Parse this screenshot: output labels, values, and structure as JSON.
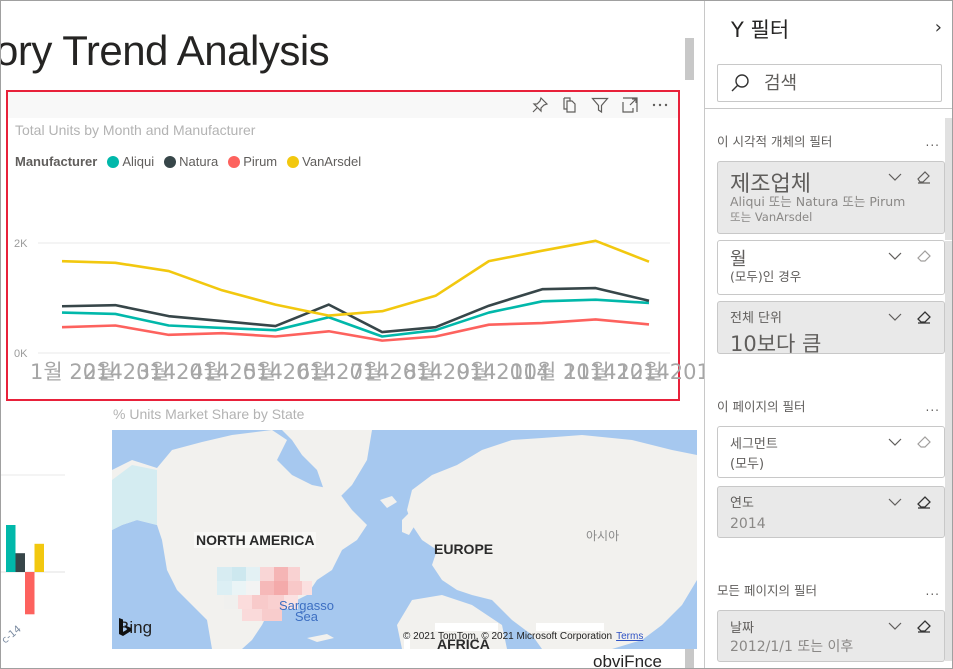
{
  "canvas": {
    "page_title": "ory Trend Analysis",
    "cut_text": "obviFnce"
  },
  "line_visual": {
    "header_icons": [
      "pin-icon",
      "copy-icon",
      "filter-icon",
      "focus-mode-icon",
      "more-options-icon"
    ],
    "more_label": "⋯"
  },
  "map_visual": {
    "title": "% Units Market Share by State",
    "labels": {
      "north_america": "NORTH AMERICA",
      "europe": "EUROPE",
      "asia": "아시아",
      "sea_line1": "Sargasso",
      "sea_line2": "Sea",
      "africa": "AFRICA"
    },
    "bing": "Bing",
    "copyright": "© 2021 TomTom, © 2021 Microsoft Corporation",
    "terms": "Terms"
  },
  "bar_fragment": {
    "axis_label": "c-14",
    "colors": [
      "#01B8AA",
      "#374649",
      "#FD625E",
      "#F2C80F"
    ],
    "values": [
      1.0,
      0.4,
      -0.9,
      0.6
    ]
  },
  "chart_data": {
    "type": "line",
    "title": "Total Units by Month and Manufacturer",
    "legend_title": "Manufacturer",
    "legend_position": "top-left",
    "xlabel": "",
    "ylabel": "",
    "x": [
      "1월 2014",
      "2월 2014",
      "3월 2014",
      "4월 2014",
      "5월 2014",
      "6월 2014",
      "7월 2014",
      "8월 2014",
      "9월 2014",
      "10월 2014",
      "11월 2014",
      "12월 2014"
    ],
    "x_tick_overlap_text": [
      "1월",
      "24월",
      "34월",
      "44월",
      "54월",
      "64월",
      "74월",
      "84월",
      "94월",
      "10월",
      "11월",
      "12월",
      "14일"
    ],
    "yticks": [
      "0K",
      "2K"
    ],
    "ylim": [
      0,
      2000
    ],
    "grid": true,
    "series": [
      {
        "name": "Aliqui",
        "color": "#01B8AA",
        "values": [
          735,
          710,
          500,
          455,
          415,
          650,
          300,
          415,
          735,
          940,
          970,
          910
        ]
      },
      {
        "name": "Natura",
        "color": "#374649",
        "values": [
          850,
          870,
          670,
          580,
          490,
          880,
          380,
          470,
          860,
          1160,
          1180,
          950
        ]
      },
      {
        "name": "Pirum",
        "color": "#FD625E",
        "values": [
          470,
          500,
          330,
          360,
          300,
          395,
          225,
          300,
          515,
          545,
          610,
          520
        ]
      },
      {
        "name": "VanArsdel",
        "color": "#F2C80F",
        "values": [
          1670,
          1640,
          1490,
          1140,
          880,
          680,
          760,
          1040,
          1670,
          1860,
          2040,
          1660
        ]
      }
    ]
  },
  "filter_pane": {
    "title": "Y 필터",
    "collapse": "›",
    "search_placeholder": "검색",
    "sections": {
      "visual": {
        "title": "이 시각적 개체의 필터",
        "more": "...",
        "cards": [
          {
            "name": "제조업체",
            "value": "Aliqui 또는 Natura 또는 Pirum 또는 VanArsdel",
            "value_line1": "Aliqui 또는 Natura 또는 Pirum",
            "value_line2": "또는 VanArsdel",
            "active": true
          },
          {
            "name": "월",
            "value": "(모두)인 경우",
            "active": false
          },
          {
            "name": "전체 단위",
            "value": "10보다 큼",
            "active": true
          }
        ]
      },
      "page": {
        "title": "이 페이지의 필터",
        "more": "...",
        "cards": [
          {
            "name": "세그먼트",
            "value": "(모두)",
            "active": false
          },
          {
            "name": "연도",
            "value": "2014",
            "active": true
          }
        ]
      },
      "all_pages": {
        "title": "모든 페이지의 필터",
        "more": "...",
        "cards": [
          {
            "name": "날짜",
            "value": "2012/1/1 또는 이후",
            "active": true
          }
        ]
      }
    }
  }
}
